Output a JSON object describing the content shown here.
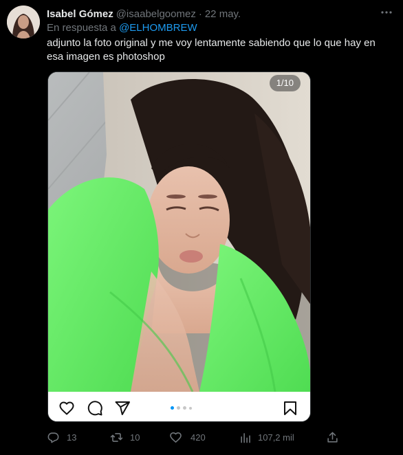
{
  "tweet": {
    "author_name": "Isabel Gómez",
    "author_handle": "@isaabelgoomez",
    "separator": "·",
    "date": "22 may.",
    "reply_prefix": "En respuesta a",
    "reply_mention": "@ELHOMBREW",
    "text": "adjunto la foto original y me voy lentamente sabiendo que lo que hay en esa imagen es photoshop"
  },
  "media": {
    "counter": "1/10",
    "carousel_dots": 5,
    "active_dot": 0,
    "icons": [
      "heart-icon",
      "comment-icon",
      "send-icon",
      "bookmark-icon"
    ]
  },
  "actions": {
    "replies": "13",
    "retweets": "10",
    "likes": "420",
    "views": "107,2 mil"
  },
  "colors": {
    "background": "#000000",
    "text_primary": "#e7e9ea",
    "text_secondary": "#71767b",
    "accent": "#1d9bf0",
    "garment_green": "#6ef06a",
    "carousel_active": "#0095f6"
  }
}
